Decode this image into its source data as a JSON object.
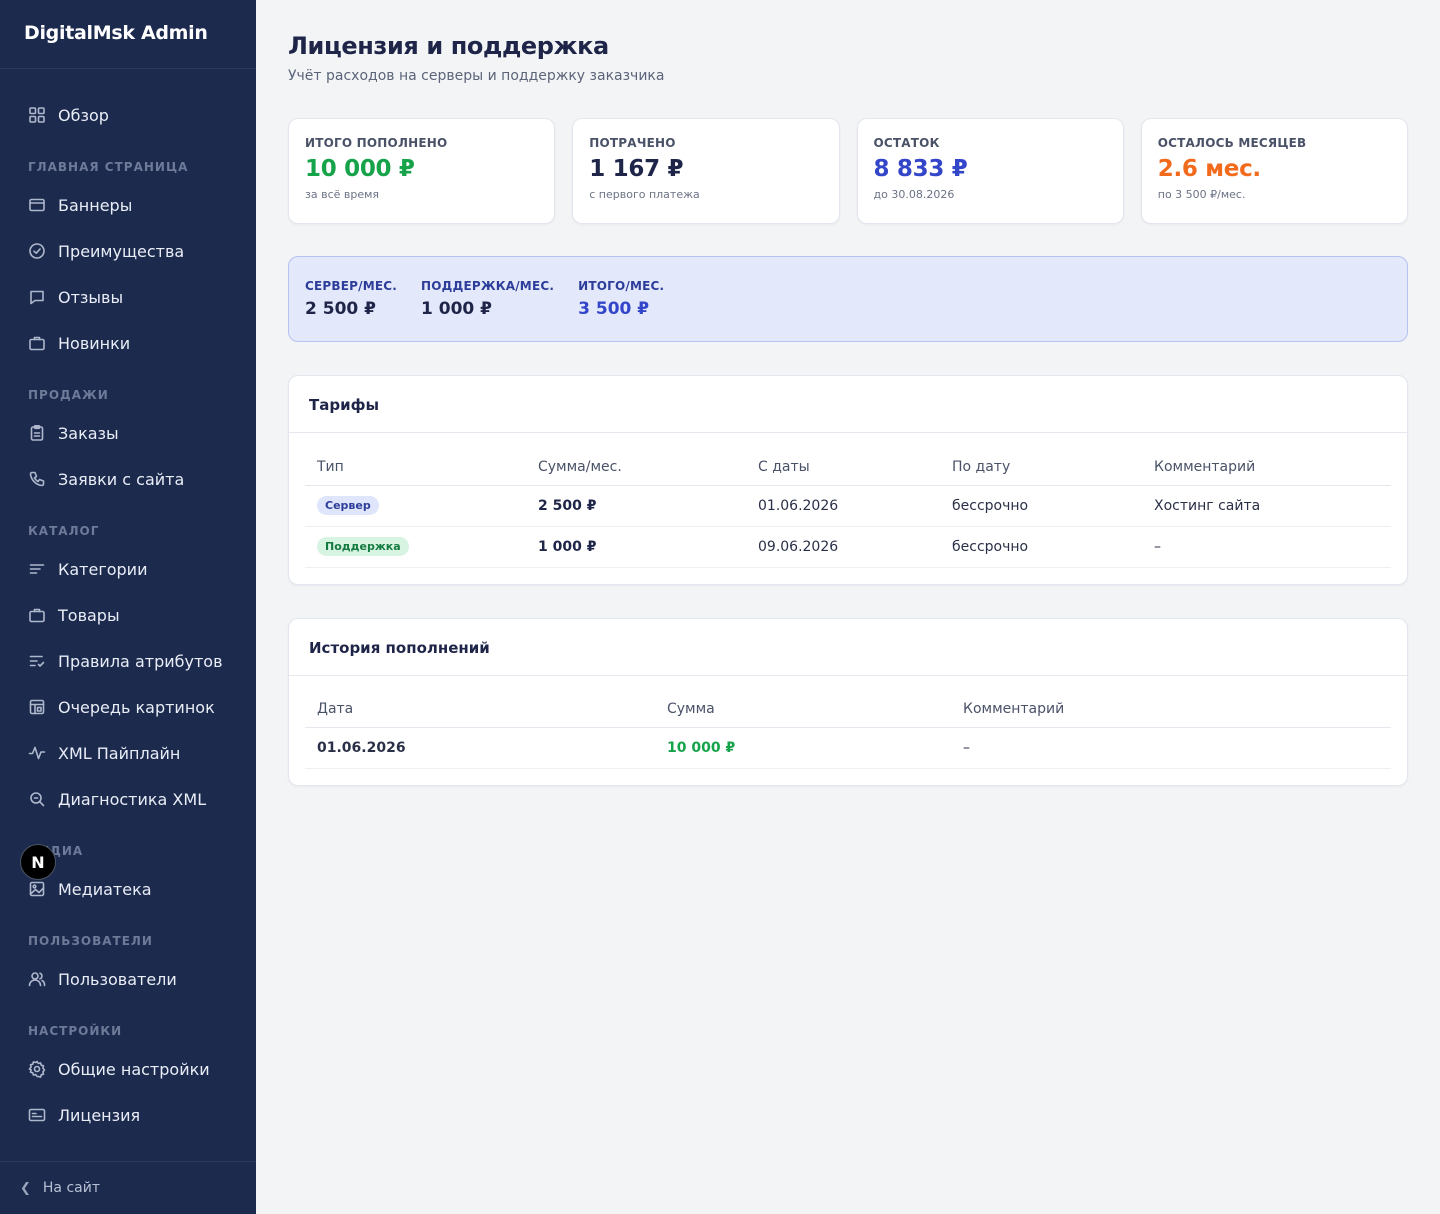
{
  "sidebar": {
    "brand": "DigitalMsk Admin",
    "overview": "Обзор",
    "sections": {
      "main_page": "Главная страница",
      "sales": "Продажи",
      "catalog": "Каталог",
      "media": "Медиа",
      "users": "Пользователи",
      "settings": "Настройки"
    },
    "items": {
      "banners": "Баннеры",
      "advantages": "Преимущества",
      "reviews": "Отзывы",
      "news": "Новинки",
      "orders": "Заказы",
      "requests": "Заявки с сайта",
      "categories": "Категории",
      "products": "Товары",
      "attr_rules": "Правила атрибутов",
      "image_queue": "Очередь картинок",
      "xml_pipeline": "XML Пайплайн",
      "xml_diagnostics": "Диагностика XML",
      "media_library": "Медиатека",
      "users": "Пользователи",
      "general_settings": "Общие настройки",
      "license": "Лицензия"
    },
    "footer": "На сайт",
    "badge": "N"
  },
  "header": {
    "title": "Лицензия и поддержка",
    "subtitle": "Учёт расходов на серверы и поддержку заказчика"
  },
  "stats": [
    {
      "label": "Итого пополнено",
      "value": "10 000 ₽",
      "note": "за всё время",
      "color": "#16a34a"
    },
    {
      "label": "Потрачено",
      "value": "1 167 ₽",
      "note": "с первого платежа",
      "color": "#1e2548"
    },
    {
      "label": "Остаток",
      "value": "8 833 ₽",
      "note": "до 30.08.2026",
      "color": "#3345c9"
    },
    {
      "label": "Осталось месяцев",
      "value": "2.6 мес.",
      "note": "по 3 500 ₽/мес.",
      "color": "#f26a1b"
    }
  ],
  "rates": [
    {
      "label": "Сервер/мес.",
      "value": "2 500 ₽",
      "color": "#1e2548"
    },
    {
      "label": "Поддержка/мес.",
      "value": "1 000 ₽",
      "color": "#1e2548"
    },
    {
      "label": "Итого/мес.",
      "value": "3 500 ₽",
      "color": "#3345c9"
    }
  ],
  "tariffs": {
    "title": "Тарифы",
    "columns": [
      "Тип",
      "Сумма/мес.",
      "С даты",
      "По дату",
      "Комментарий"
    ],
    "rows": [
      {
        "type": "Сервер",
        "amount": "2 500 ₽",
        "from": "01.06.2026",
        "to": "бессрочно",
        "comment": "Хостинг сайта"
      },
      {
        "type": "Поддержка",
        "amount": "1 000 ₽",
        "from": "09.06.2026",
        "to": "бессрочно",
        "comment": "–"
      }
    ]
  },
  "history": {
    "title": "История пополнений",
    "columns": [
      "Дата",
      "Сумма",
      "Комментарий"
    ],
    "rows": [
      {
        "date": "01.06.2026",
        "amount": "10 000 ₽",
        "comment": "–"
      }
    ]
  }
}
